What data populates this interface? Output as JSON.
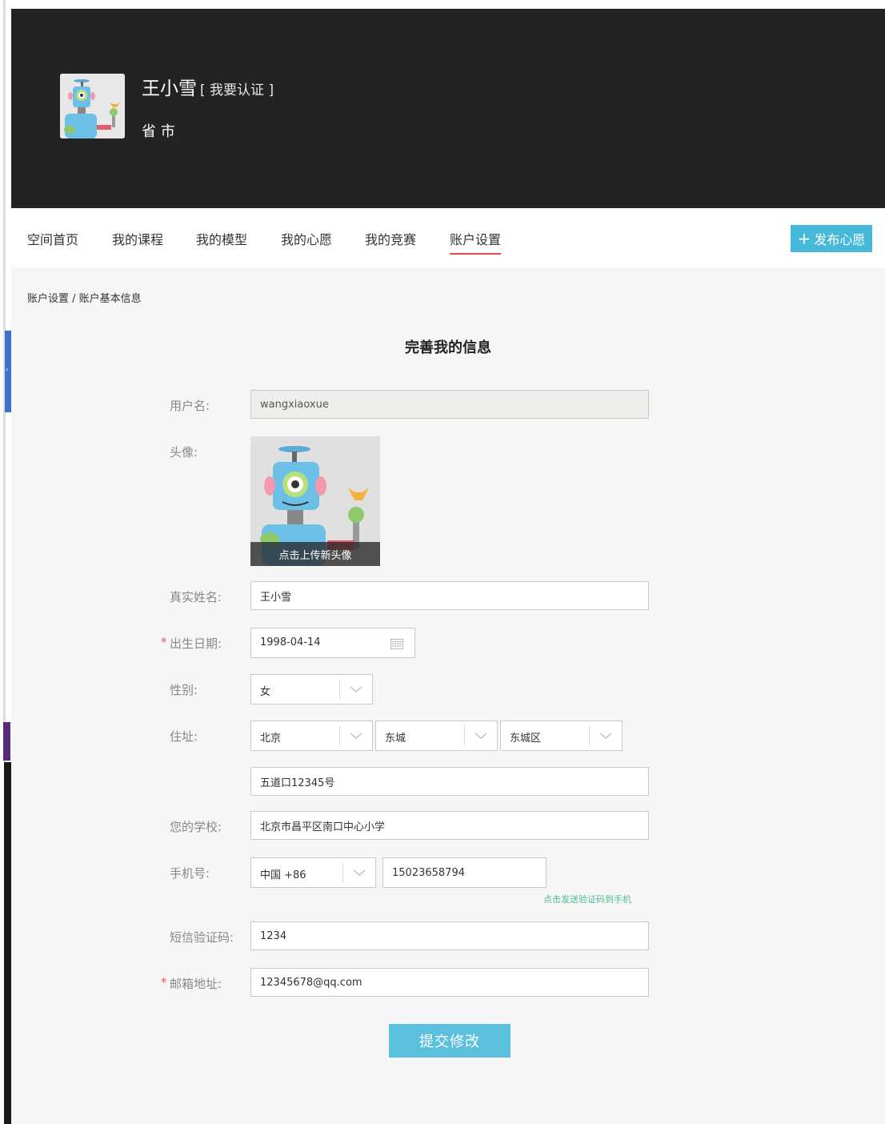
{
  "header": {
    "name": "王小雪",
    "verify_link": "[ 我要认证 ]",
    "location": "省 市"
  },
  "nav": {
    "tabs": [
      {
        "label": "空间首页"
      },
      {
        "label": "我的课程"
      },
      {
        "label": "我的模型"
      },
      {
        "label": "我的心愿"
      },
      {
        "label": "我的竞赛"
      },
      {
        "label": "账户设置",
        "active": true
      }
    ],
    "publish_label": "发布心愿",
    "publish_icon": "plus-icon",
    "active_color": "#e0533a",
    "button_color": "#46b8da"
  },
  "breadcrumb": "账户设置 / 账户基本信息",
  "form": {
    "title": "完善我的信息",
    "username": {
      "label": "用户名:",
      "value": "wangxiaoxue"
    },
    "avatar": {
      "label": "头像:",
      "upload_text": "点击上传新头像"
    },
    "real_name": {
      "label": "真实姓名:",
      "value": "王小雪"
    },
    "birthday": {
      "required": "*",
      "label": "出生日期:",
      "value": "1998-04-14",
      "icon": "calendar-icon"
    },
    "gender": {
      "label": "性别:",
      "value": "女"
    },
    "address": {
      "label": "住址:",
      "province": "北京",
      "city": "东城",
      "district": "东城区",
      "detail": "五道口12345号"
    },
    "school": {
      "label": "您的学校:",
      "value": "北京市昌平区南口中心小学"
    },
    "phone": {
      "label": "手机号:",
      "country": "中国 +86",
      "value": "15023658794",
      "send_code": "点击发送验证码到手机"
    },
    "sms_code": {
      "label": "短信验证码:",
      "value": "1234"
    },
    "email": {
      "required": "*",
      "label": "邮箱地址:",
      "value": "12345678@qq.com"
    },
    "submit_label": "提交修改",
    "submit_color": "#5bc0de"
  }
}
